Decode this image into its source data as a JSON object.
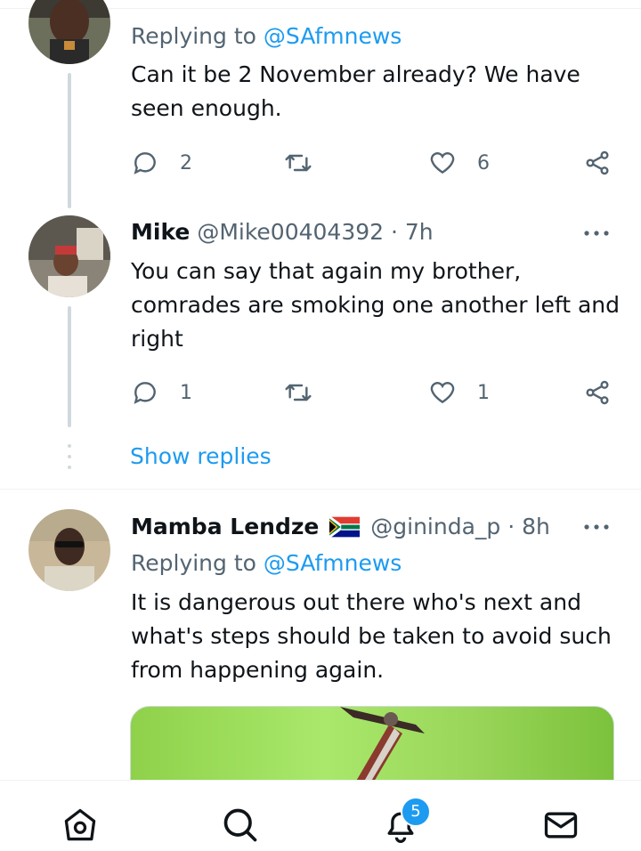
{
  "tweets": [
    {
      "replying_label": "Replying to",
      "replying_handle": "@SAfmnews",
      "text_lines": [
        "Can it be 2 November already? We have",
        "seen enough."
      ],
      "replies": "2",
      "likes": "6"
    },
    {
      "name": "Mike",
      "handle_time": "@Mike00404392 · 7h",
      "text_lines": [
        "You can say that again my brother,",
        "comrades are smoking one another left and",
        "right"
      ],
      "replies": "1",
      "likes": "1"
    },
    {
      "name": "Mamba Lendze",
      "handle_time": "@gininda_p · 8h",
      "replying_label": "Replying to",
      "replying_handle": "@SAfmnews",
      "text_lines": [
        "It is dangerous out there who's next and",
        "what's steps should be taken to avoid such",
        "from happening again."
      ]
    }
  ],
  "show_replies": "Show replies",
  "nav": {
    "items": [
      "home-icon",
      "search-icon",
      "notifications-icon",
      "messages-icon"
    ],
    "notification_badge": "5"
  },
  "colors": {
    "accent": "#1d9bf0",
    "text": "#0f1419",
    "secondary": "#536471",
    "thread_line": "#cfd9de"
  }
}
